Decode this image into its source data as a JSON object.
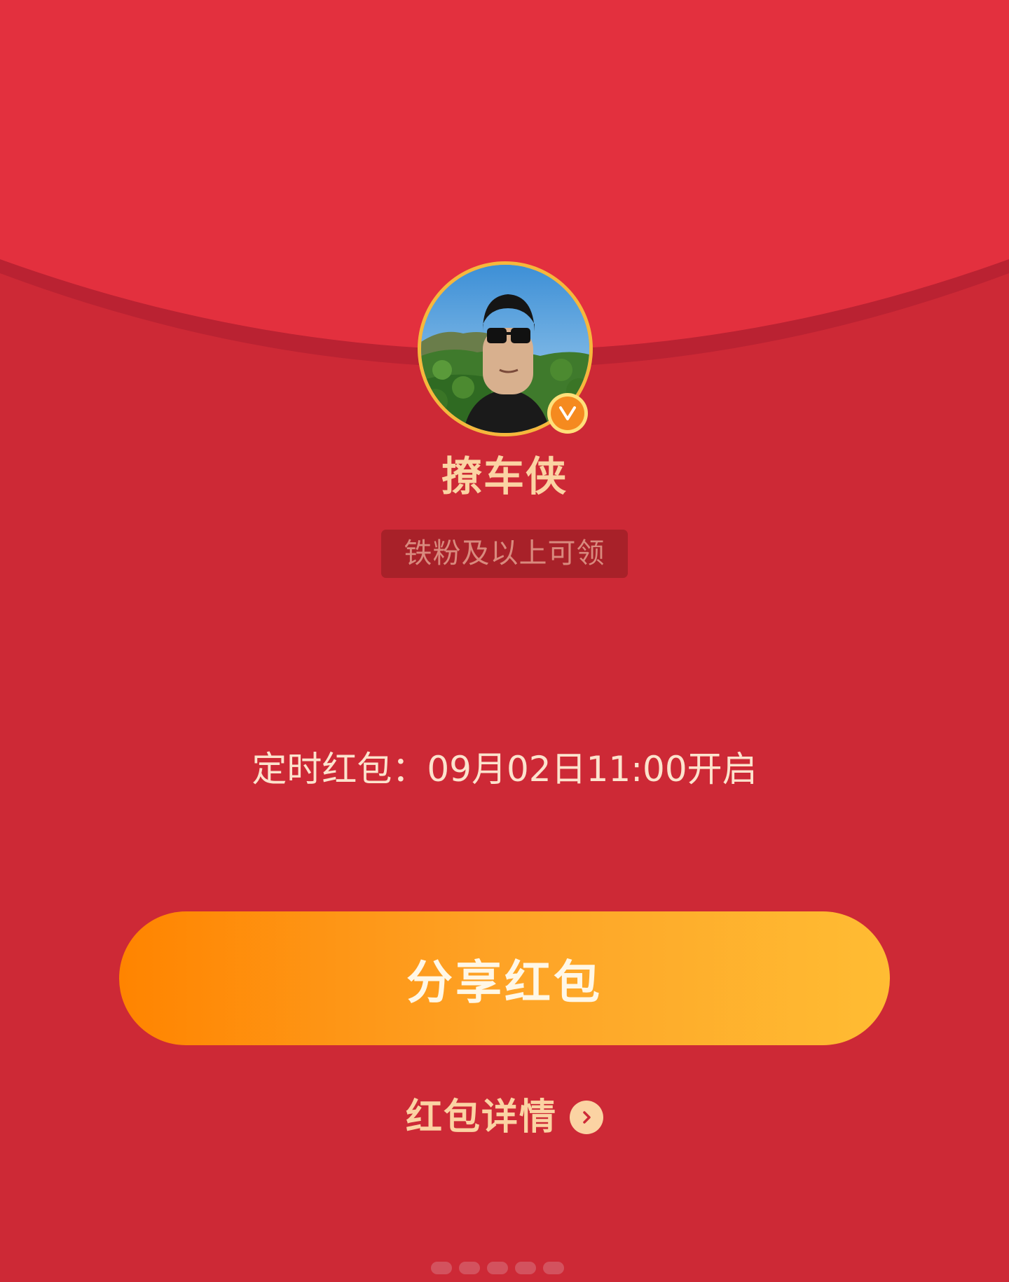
{
  "colors": {
    "background": "#cd2936",
    "flap": "#e3303e",
    "accent_gold": "#fbd3a3",
    "button_start": "#ff8400",
    "button_end": "#ffbc33"
  },
  "envelope": {
    "flap_icon": "red-envelope-flap"
  },
  "sender": {
    "avatar_icon": "user-avatar-photo",
    "verified_icon": "verified-v-badge",
    "name": "撩车侠"
  },
  "eligibility": {
    "label": "铁粉及以上可领"
  },
  "timer": {
    "text": "定时红包：09月02日11:00开启"
  },
  "actions": {
    "share_label": "分享红包",
    "details_label": "红包详情",
    "details_icon": "chevron-right-circle-icon"
  }
}
